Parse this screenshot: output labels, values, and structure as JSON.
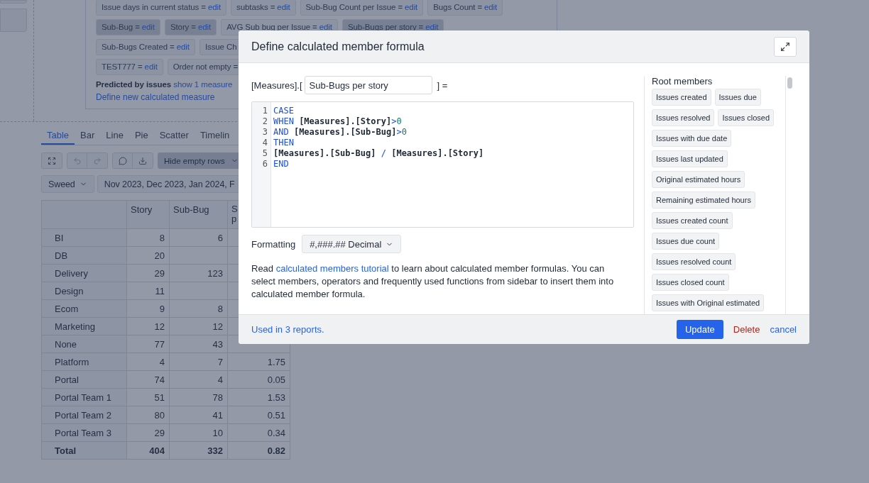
{
  "measures": {
    "rows": [
      {
        "chips": [
          {
            "label": "Issue days in current status =",
            "link": "edit",
            "selected": false
          },
          {
            "label": "subtasks =",
            "link": "edit",
            "selected": false
          },
          {
            "label": "Sub-Bug Count per Issue =",
            "link": "edit",
            "selected": false
          },
          {
            "label": "Bugs Count =",
            "link": "edit",
            "selected": false
          }
        ]
      },
      {
        "chips": [
          {
            "label": "Sub-Bug =",
            "link": "edit",
            "selected": true
          },
          {
            "label": "Story =",
            "link": "edit",
            "selected": true
          },
          {
            "label": "AVG Sub bug per Issue =",
            "link": "edit",
            "selected": false
          },
          {
            "label": "Sub-Bugs per story =",
            "link": "edit",
            "selected": true
          }
        ]
      },
      {
        "chips": [
          {
            "label": "Sub-Bugs Created =",
            "link": "edit",
            "selected": false
          },
          {
            "label": "Issue Ch",
            "selected": false
          }
        ]
      },
      {
        "chips": [
          {
            "label": "TEST777 =",
            "link": "edit",
            "selected": false
          },
          {
            "label": "Order not empty =",
            "selected": false
          }
        ]
      }
    ],
    "predicted": {
      "label": "Predicted by issues",
      "link": "show 1 measure"
    },
    "define_link": "Define new calculated measure"
  },
  "tabs": [
    {
      "label": "Table",
      "selected": true
    },
    {
      "label": "Bar",
      "selected": false
    },
    {
      "label": "Line",
      "selected": false
    },
    {
      "label": "Pie",
      "selected": false
    },
    {
      "label": "Scatter",
      "selected": false
    },
    {
      "label": "Timelin",
      "selected": false
    }
  ],
  "toolbar": {
    "hide_empty_rows": {
      "label": "Hide empty rows",
      "on": true
    }
  },
  "filters": {
    "dimension": "Sweed",
    "periods": "Nov 2023, Dec 2023, Jan 2024, F"
  },
  "table": {
    "columns": [
      "Story",
      "Sub-Bug",
      "S p"
    ],
    "rows": [
      {
        "name": "BI",
        "story": "8",
        "sub_bug": "6"
      },
      {
        "name": "DB",
        "story": "20"
      },
      {
        "name": "Delivery",
        "story": "29",
        "sub_bug": "123"
      },
      {
        "name": "Design",
        "story": "11"
      },
      {
        "name": "Ecom",
        "story": "9",
        "sub_bug": "8"
      },
      {
        "name": "Marketing",
        "story": "12",
        "sub_bug": "12"
      },
      {
        "name": "None",
        "story": "77",
        "sub_bug": "43"
      },
      {
        "name": "Platform",
        "story": "4",
        "sub_bug": "7",
        "column_3": "1.75"
      },
      {
        "name": "Portal",
        "story": "74",
        "sub_bug": "4",
        "column_3": "0.05"
      },
      {
        "name": "Portal Team 1",
        "story": "51",
        "sub_bug": "78",
        "column_3": "1.53"
      },
      {
        "name": "Portal Team 2",
        "story": "80",
        "sub_bug": "41",
        "column_3": "0.51"
      },
      {
        "name": "Portal Team 3",
        "story": "29",
        "sub_bug": "10",
        "column_3": "0.34"
      }
    ],
    "total": {
      "name": "Total",
      "story": "404",
      "sub_bug": "332",
      "column_3": "0.82"
    }
  },
  "dialog": {
    "title": "Define calculated member formula",
    "name_prefix": "[Measures].[",
    "name_value": "Sub-Bugs per story",
    "name_suffix": "] =",
    "line_numbers": [
      "1",
      "2",
      "3",
      "4",
      "5",
      "6"
    ],
    "code": [
      [
        {
          "kind": "keyword",
          "text": "CASE"
        }
      ],
      [
        {
          "kind": "keyword",
          "text": "WHEN"
        },
        {
          "kind": "ident",
          "text": " [Measures].[Story]"
        },
        {
          "kind": "op",
          "text": ">"
        },
        {
          "kind": "number",
          "text": "0"
        }
      ],
      [
        {
          "kind": "keyword",
          "text": "AND"
        },
        {
          "kind": "ident",
          "text": " [Measures].[Sub-Bug]"
        },
        {
          "kind": "op",
          "text": ">"
        },
        {
          "kind": "number",
          "text": "0"
        }
      ],
      [
        {
          "kind": "keyword",
          "text": "THEN"
        }
      ],
      [
        {
          "kind": "ident",
          "text": "[Measures].[Sub-Bug] "
        },
        {
          "kind": "op",
          "text": "/"
        },
        {
          "kind": "ident",
          "text": " [Measures].[Story]"
        }
      ],
      [
        {
          "kind": "keyword",
          "text": "END"
        }
      ]
    ],
    "formatting_label": "Formatting",
    "formatting_value": "#,###.## Decimal",
    "help": {
      "before": "Read ",
      "link": "calculated members tutorial",
      "after": " to learn about calculated member formulas. You can select members, operators and frequently used functions from sidebar to insert them into calculated member formula."
    },
    "sidebar": {
      "title": "Root members",
      "members": [
        "Issues created",
        "Issues due",
        "Issues resolved",
        "Issues closed",
        "Issues with due date",
        "Issues last updated",
        "Original estimated hours",
        "Remaining estimated hours",
        "Issues created count",
        "Issues due count",
        "Issues resolved count",
        "Issues closed count",
        "Issues with Original estimated"
      ]
    },
    "used_in": "Used in 3 reports.",
    "update": "Update",
    "delete": "Delete",
    "cancel": "cancel"
  }
}
